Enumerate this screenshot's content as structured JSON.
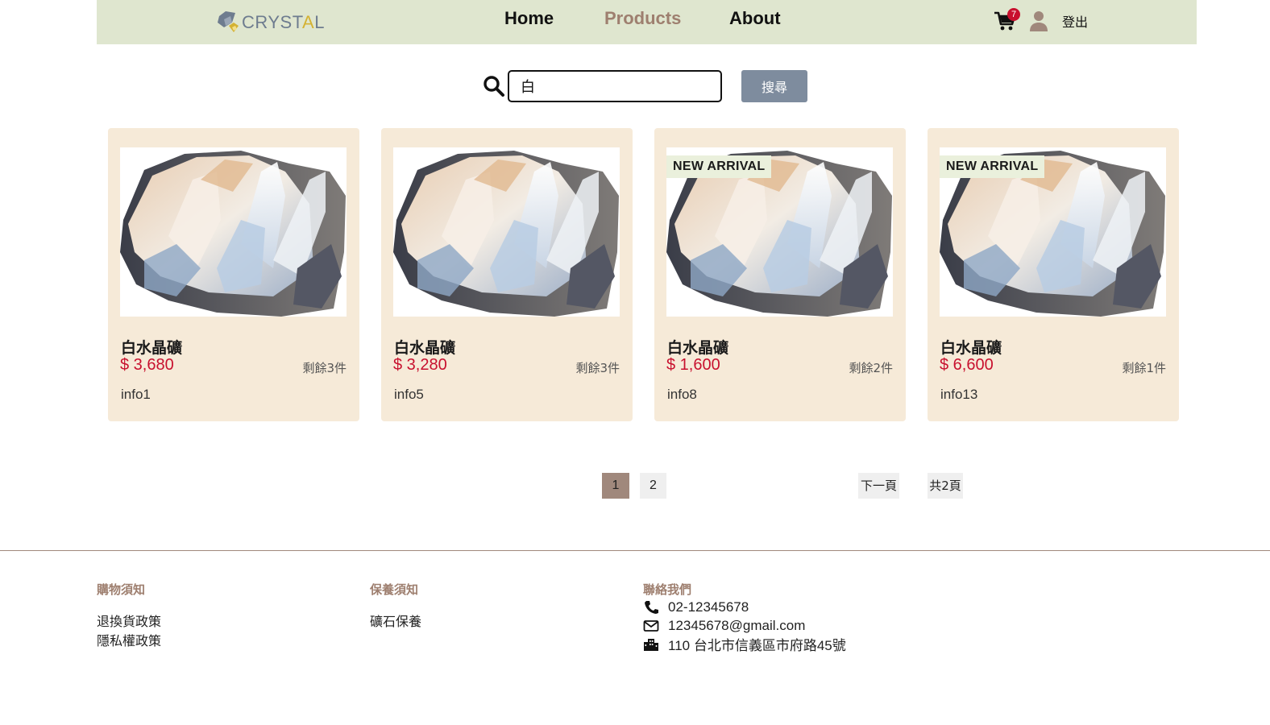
{
  "header": {
    "logo_text_1": "CRYST",
    "logo_text_2": "A",
    "logo_text_3": "L",
    "nav": {
      "home": "Home",
      "products": "Products",
      "about": "About"
    },
    "cart_count": "7",
    "logout": "登出"
  },
  "search": {
    "value": "白",
    "button": "搜尋"
  },
  "products": [
    {
      "name": "白水晶礦",
      "price": "$ 3,680",
      "stock": "剩餘3件",
      "info": "info1",
      "badge": ""
    },
    {
      "name": "白水晶礦",
      "price": "$ 3,280",
      "stock": "剩餘3件",
      "info": "info5",
      "badge": ""
    },
    {
      "name": "白水晶礦",
      "price": "$ 1,600",
      "stock": "剩餘2件",
      "info": "info8",
      "badge": "NEW ARRIVAL"
    },
    {
      "name": "白水晶礦",
      "price": "$ 6,600",
      "stock": "剩餘1件",
      "info": "info13",
      "badge": "NEW ARRIVAL"
    }
  ],
  "pagination": {
    "page1": "1",
    "page2": "2",
    "next": "下一頁",
    "total": "共2頁"
  },
  "footer": {
    "shopping": {
      "title": "購物須知",
      "links": [
        "退換貨政策",
        "隱私權政策"
      ]
    },
    "care": {
      "title": "保養須知",
      "links": [
        "礦石保養"
      ]
    },
    "contact": {
      "title": "聯絡我們",
      "phone": "02-12345678",
      "email": "12345678@gmail.com",
      "address": "110 台北市信義區市府路45號"
    }
  },
  "colors": {
    "header_bg": "#dfe6cf",
    "card_bg": "#f6ead8",
    "price": "#c8102e",
    "accent_brown": "#a0887c",
    "search_button": "#7e8c9e"
  }
}
